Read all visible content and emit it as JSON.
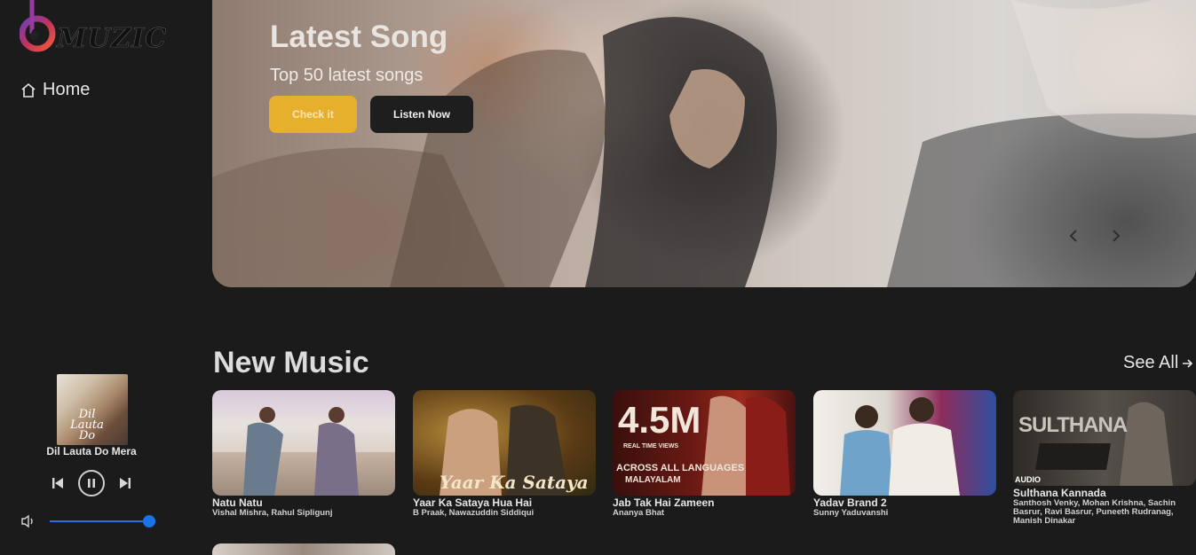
{
  "app": {
    "logo_text": "MUZIC"
  },
  "sidebar": {
    "home_label": "Home"
  },
  "now_playing": {
    "cover_text": "Dil Lauta Do",
    "title": "Dil Lauta Do Mera",
    "volume": 0.92
  },
  "hero": {
    "title": "Latest Song",
    "subtitle": "Top 50 latest songs",
    "check_label": "Check it",
    "listen_label": "Listen Now"
  },
  "new_music": {
    "title": "New Music",
    "see_all": "See All",
    "cards": [
      {
        "title": "Natu Natu",
        "artists": "Vishal Mishra, Rahul Sipligunj"
      },
      {
        "title": "Yaar Ka Sataya Hua Hai",
        "artists": "B Praak, Nawazuddin Siddiqui",
        "overlay": "Yaar Ka Sataya"
      },
      {
        "title": "Jab Tak Hai Zameen",
        "artists": "Ananya Bhat",
        "overlay_big": "4.5M",
        "overlay_small": "REAL TIME VIEWS",
        "overlay_line1": "ACROSS ALL LANGUAGES",
        "overlay_line2": "MALAYALAM"
      },
      {
        "title": "Yadav Brand 2",
        "artists": "Sunny Yaduvanshi"
      },
      {
        "title": "Sulthana Kannada",
        "artists": "Santhosh Venky, Mohan Krishna, Sachin Basrur, Ravi Basrur, Puneeth Rudranag, Manish Dinakar",
        "overlay": "SULTHANA",
        "badge": "AUDIO"
      }
    ]
  },
  "colors": {
    "accent": "#e6b02d",
    "volume": "#1a73e8",
    "background": "#1b1b1b"
  }
}
